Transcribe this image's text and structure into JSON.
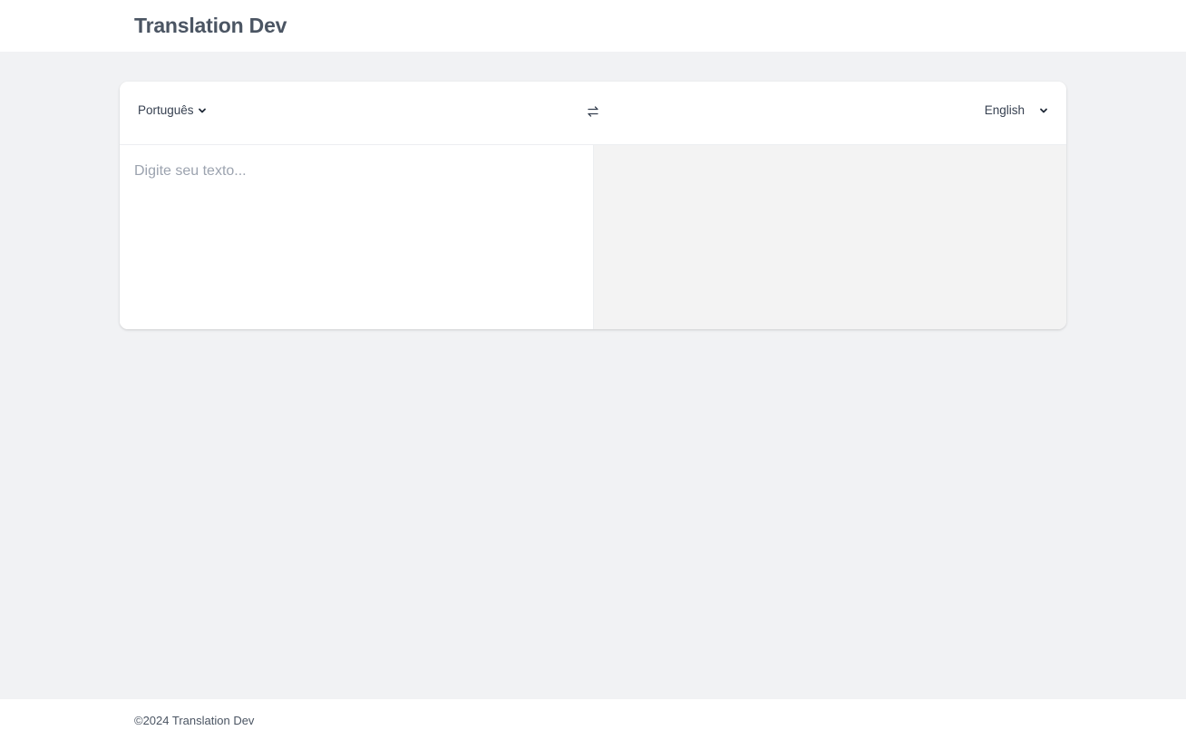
{
  "header": {
    "brand": "Translation Dev"
  },
  "translator": {
    "source_language": "Português",
    "target_language": "English",
    "input": {
      "value": "",
      "placeholder": "Digite seu texto..."
    },
    "output": {
      "value": ""
    },
    "icons": {
      "source_dropdown": "chevron-down-icon",
      "swap": "swap-arrows-icon",
      "target_dropdown": "chevron-down-icon"
    }
  },
  "footer": {
    "copyright": "©2024 Translation Dev"
  },
  "colors": {
    "page_background": "#f1f2f4",
    "card_background": "#ffffff",
    "output_background": "#f3f3f3",
    "brand_text": "#4b5563"
  }
}
